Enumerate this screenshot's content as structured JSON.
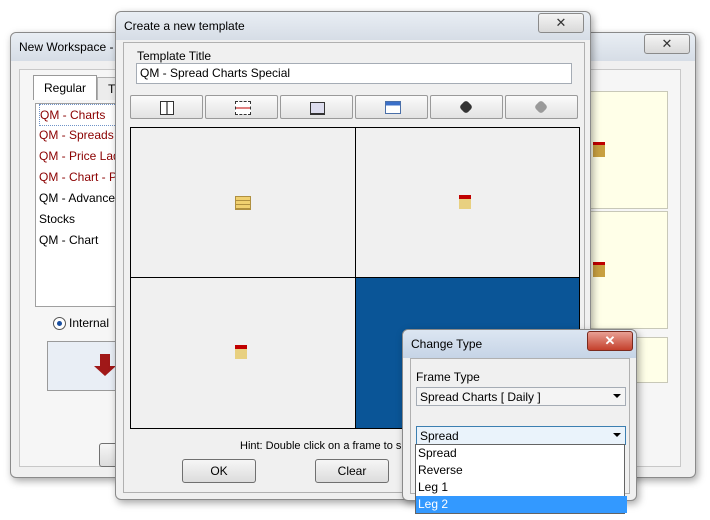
{
  "workspace": {
    "title": "New Workspace -",
    "tabs": [
      {
        "label": "Regular"
      },
      {
        "label": "T"
      }
    ],
    "items": [
      {
        "label": "QM - Charts",
        "color": "#8b0000"
      },
      {
        "label": "QM - Spreads",
        "color": "#8b0000"
      },
      {
        "label": "QM - Price Lad",
        "color": "#8b0000"
      },
      {
        "label": "QM - Chart - P",
        "color": "#8b0000"
      },
      {
        "label": "QM - Advance",
        "color": "#000000"
      },
      {
        "label": "Stocks",
        "color": "#000000"
      },
      {
        "label": "QM - Chart",
        "color": "#000000"
      }
    ],
    "radio_label": "Internal"
  },
  "template": {
    "title": "Create a new template",
    "title_label": "Template Title",
    "title_value": "QM - Spread Charts Special",
    "toolbar": [
      "split-vertical-icon",
      "split-horizontal-icon",
      "chart-type-icon",
      "window-icon",
      "clear-icon",
      "clear-disabled-icon"
    ],
    "frames": [
      {
        "icon": "table-icon",
        "selected": false
      },
      {
        "icon": "house-chart-icon",
        "selected": false
      },
      {
        "icon": "house-chart-icon",
        "selected": false
      },
      {
        "icon": "",
        "selected": true
      }
    ],
    "hint": "Hint: Double click on a frame to sp",
    "ok_label": "OK",
    "clear_label": "Clear",
    "selected_color": "#0a5597"
  },
  "change_type": {
    "title": "Change Type",
    "frame_type_label": "Frame Type",
    "frame_type_value": "Spread Charts [ Daily ]",
    "type_value": "Spread",
    "options": [
      {
        "label": "Spread",
        "selected": false
      },
      {
        "label": "Reverse",
        "selected": false
      },
      {
        "label": "Leg 1",
        "selected": false
      },
      {
        "label": "Leg 2",
        "selected": true
      }
    ],
    "highlight_color": "#3399ff"
  }
}
